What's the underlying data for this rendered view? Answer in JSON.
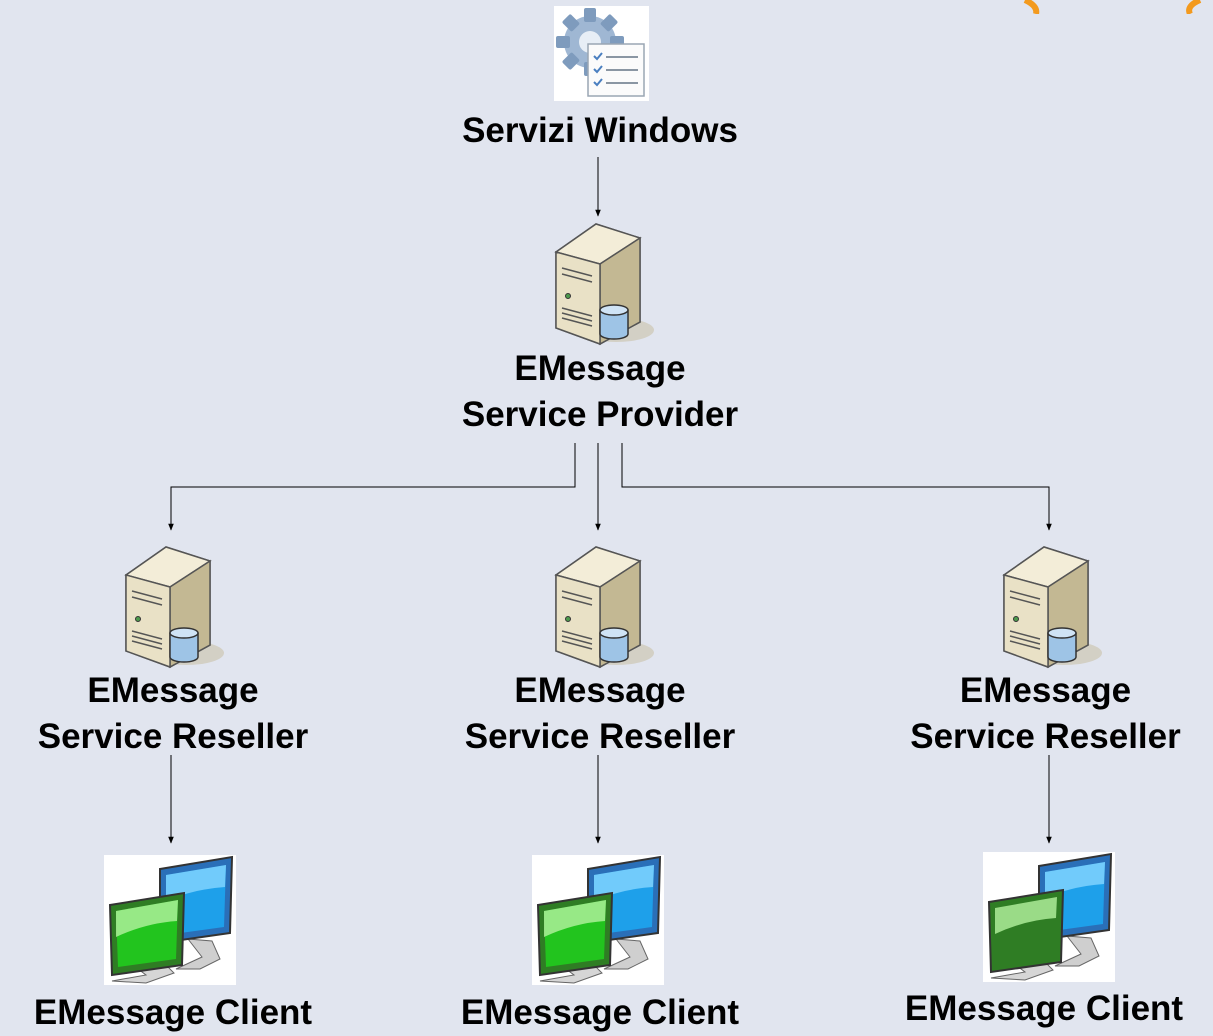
{
  "nodes": {
    "windows_services": {
      "label": "Servizi Windows",
      "icon": "services-gear-icon"
    },
    "provider": {
      "line1": "EMessage",
      "line2": "Service Provider",
      "icon": "server-database-icon"
    },
    "resellers": [
      {
        "line1": "EMessage",
        "line2": "Service Reseller",
        "icon": "server-database-icon"
      },
      {
        "line1": "EMessage",
        "line2": "Service Reseller",
        "icon": "server-database-icon"
      },
      {
        "line1": "EMessage",
        "line2": "Service Reseller",
        "icon": "server-database-icon"
      }
    ],
    "clients": [
      {
        "label": "EMessage Client",
        "icon": "client-monitors-icon"
      },
      {
        "label": "EMessage Client",
        "icon": "client-monitors-icon"
      },
      {
        "label": "EMessage Client",
        "icon": "client-monitors-icon"
      }
    ]
  },
  "edges": [
    {
      "from": "Servizi Windows",
      "to": "EMessage Service Provider"
    },
    {
      "from": "EMessage Service Provider",
      "to": "EMessage Service Reseller"
    },
    {
      "from": "EMessage Service Provider",
      "to": "EMessage Service Reseller"
    },
    {
      "from": "EMessage Service Provider",
      "to": "EMessage Service Reseller"
    },
    {
      "from": "EMessage Service Reseller",
      "to": "EMessage Client"
    },
    {
      "from": "EMessage Service Reseller",
      "to": "EMessage Client"
    },
    {
      "from": "EMessage Service Reseller",
      "to": "EMessage Client"
    }
  ],
  "colors": {
    "background": "#e1e5ef",
    "accent": "#f39a1e",
    "line": "#000000"
  }
}
